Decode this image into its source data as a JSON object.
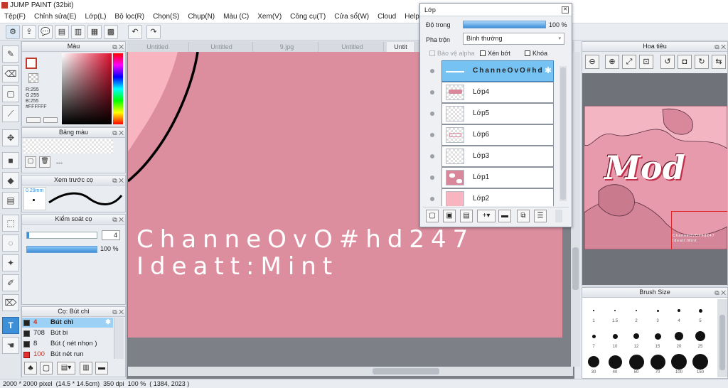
{
  "window": {
    "title": "JUMP PAINT (32bit)"
  },
  "menu": [
    "Tệp(F)",
    "Chỉnh sửa(E)",
    "Lớp(L)",
    "Bộ lọc(R)",
    "Chọn(S)",
    "Chụp(N)",
    "Màu (C)",
    "Xem(V)",
    "Công cụ(T)",
    "Cửa sổ(W)",
    "Cloud",
    "Help"
  ],
  "tabs": [
    "Untitled",
    "Untitled",
    "9.jpg",
    "Untitled",
    "Untit"
  ],
  "color_panel": {
    "title": "Màu",
    "r": "R:255",
    "g": "G:255",
    "b": "B:255",
    "hex": "#FFFFFF"
  },
  "palette_panel": {
    "title": "Bảng màu",
    "value": "---"
  },
  "brush_preview_panel": {
    "title": "Xem trước cọ",
    "size": "0.29mm"
  },
  "brush_control_panel": {
    "title": "Kiểm soát cọ",
    "size_value": "4",
    "opacity_value": "100 %"
  },
  "brush_list_panel": {
    "title": "Cọ: Bút chì",
    "items": [
      {
        "size": "4",
        "name": "Bút chì",
        "color": "#222222"
      },
      {
        "size": "708",
        "name": "Bút bi",
        "color": "#222222"
      },
      {
        "size": "8",
        "name": "Bút ( nét nhọn )",
        "color": "#222222"
      },
      {
        "size": "100",
        "name": "Bút nét run",
        "color": "#e03030"
      }
    ]
  },
  "canvas": {
    "text_line1": "ChanneOvO#hd247",
    "text_line2": "Ideatt:Mint",
    "bg": "#dc8e9f"
  },
  "layer_panel": {
    "title": "Lớp",
    "opacity_label": "Độ trong",
    "opacity_value": "100 %",
    "blend_label": "Pha trộn",
    "blend_value": "Bình thường",
    "protect_alpha": "Bảo vệ alpha",
    "clipping": "Xén bớt",
    "lock": "Khóa",
    "layers": [
      {
        "name": "ChanneOvO#hd",
        "selected": true
      },
      {
        "name": "Lớp4"
      },
      {
        "name": "Lớp5"
      },
      {
        "name": "Lớp6"
      },
      {
        "name": "Lớp3"
      },
      {
        "name": "Lớp1"
      },
      {
        "name": "Lớp2"
      }
    ]
  },
  "navigator_panel": {
    "title": "Hoa tiêu",
    "preview_logo": "Mod",
    "preview_caption_1": "ChanneOvO#hd247",
    "preview_caption_2": "Ideatt:Mint"
  },
  "brush_size_panel": {
    "title": "Brush Size",
    "sizes": [
      "1",
      "1.5",
      "2",
      "3",
      "4",
      "5",
      "7",
      "10",
      "12",
      "15",
      "20",
      "25",
      "30",
      "40",
      "50",
      "70",
      "100",
      "150"
    ]
  },
  "status": {
    "dimensions": "2000 * 2000 pixel",
    "physical": "(14.5 * 14.5cm)",
    "dpi": "350 dpi",
    "zoom": "100 %",
    "coords": "( 1384, 2023 )"
  },
  "colors": {
    "accent": "#3d8fd8",
    "canvas_pink": "#dc8e9f",
    "light_pink": "#f8b4bf"
  }
}
